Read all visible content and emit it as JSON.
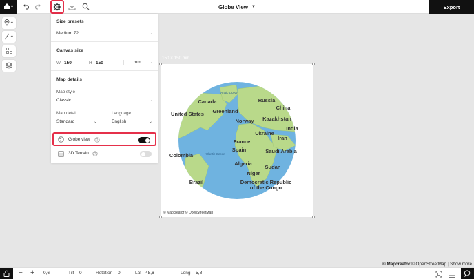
{
  "header": {
    "title": "Globe View",
    "export_label": "Export"
  },
  "settings_panel": {
    "size_presets": {
      "title": "Size presets",
      "value": "Medium 72"
    },
    "canvas_size": {
      "title": "Canvas size",
      "w_label": "W",
      "w_value": "150",
      "h_label": "H",
      "h_value": "150",
      "unit": "mm"
    },
    "map_details": {
      "title": "Map details",
      "map_style_label": "Map style",
      "map_style_value": "Classic",
      "map_detail_label": "Map detail",
      "map_detail_value": "Standard",
      "language_label": "Language",
      "language_value": "English"
    },
    "globe_view": {
      "label": "Globe view",
      "on": true
    },
    "terrain": {
      "label": "3D Terrain",
      "on": false
    }
  },
  "canvas": {
    "size_label": "150 × 150 mm",
    "attribution": "© Mapcreator © OpenStreetMap",
    "map_labels": {
      "arctic_ocean": "Arctic Ocean",
      "canada": "Canada",
      "greenland": "Greenland",
      "russia": "Russia",
      "china": "China",
      "united_states": "United States",
      "norway": "Norway",
      "kazakhstan": "Kazakhstan",
      "ukraine": "Ukraine",
      "india": "India",
      "france": "France",
      "iran": "Iran",
      "spain": "Spain",
      "saudi_arabia": "Saudi Arabia",
      "colombia": "Colombia",
      "atlantic_ocean": "Atlantic Ocean",
      "algeria": "Algeria",
      "sudan": "Sudan",
      "niger": "Niger",
      "brazil": "Brazil",
      "drc_line1": "Democratic Republic",
      "drc_line2": "of the Congo"
    }
  },
  "map_attribution": {
    "brand": "© Mapcreator",
    "osm": "© OpenStreetMap",
    "show_more": "Show more"
  },
  "status_bar": {
    "zoom_value": "0,6",
    "tilt_label": "Tilt",
    "tilt_value": "0",
    "rotation_label": "Rotation",
    "rotation_value": "0",
    "lat_label": "Lat",
    "lat_value": "48,6",
    "long_label": "Long",
    "long_value": "-5,8"
  },
  "colors": {
    "accent_red": "#e5304a",
    "ocean": "#6fb3e0",
    "land": "#b9d98a",
    "toggle_on": "#111111",
    "toggle_off": "#dddddd"
  },
  "icons": [
    "home-icon",
    "undo-icon",
    "redo-icon",
    "gear-icon",
    "download-icon",
    "search-icon",
    "pin-icon",
    "line-icon",
    "grid-icon",
    "layers-icon",
    "globe-icon",
    "help-icon",
    "terrain-icon",
    "lock-icon",
    "minus-icon",
    "plus-icon",
    "fit-icon",
    "table-icon",
    "chat-icon"
  ]
}
